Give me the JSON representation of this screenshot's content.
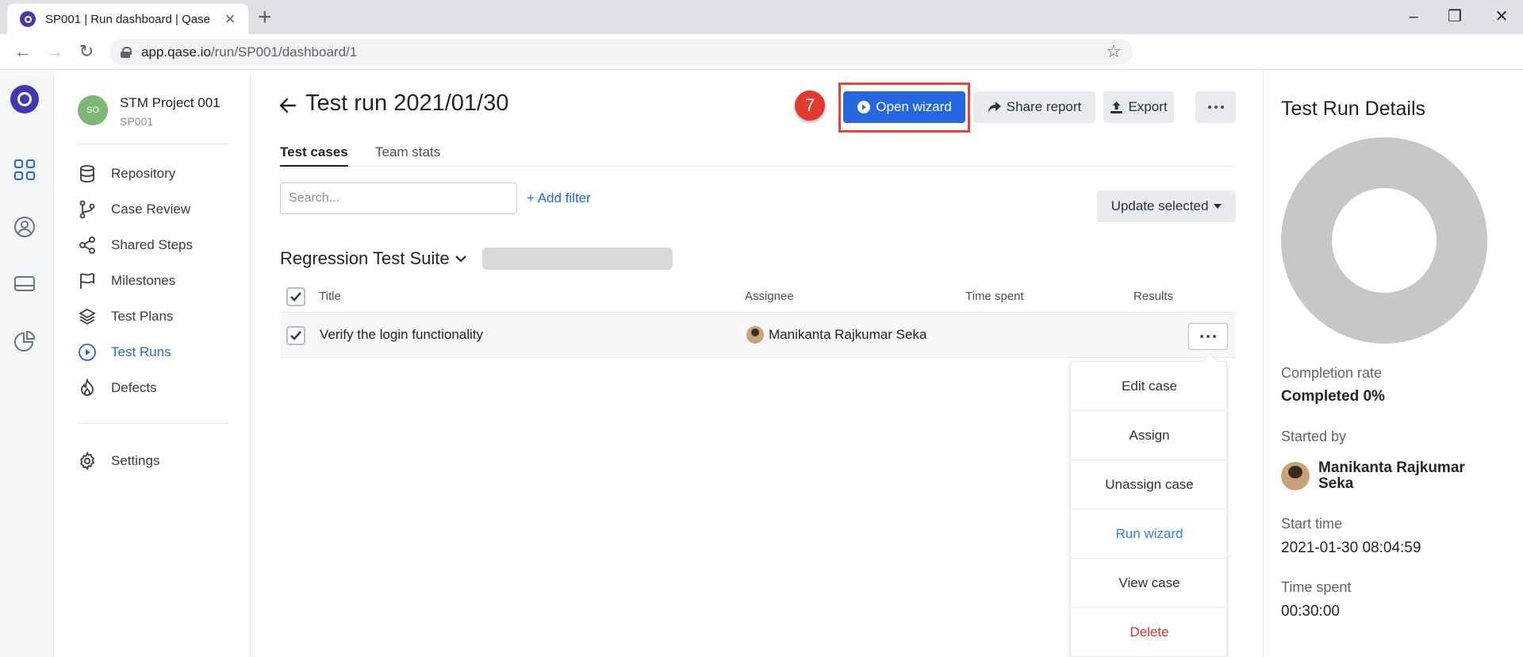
{
  "browser": {
    "tab_title": "SP001 | Run dashboard | Qase",
    "url_host": "app.qase.io",
    "url_path": "/run/SP001/dashboard/1"
  },
  "project": {
    "avatar_initials": "SO",
    "name": "STM Project 001",
    "code": "SP001"
  },
  "sidebar": {
    "items": [
      {
        "label": "Repository",
        "icon": "database-icon"
      },
      {
        "label": "Case Review",
        "icon": "git-branch-icon"
      },
      {
        "label": "Shared Steps",
        "icon": "share-icon"
      },
      {
        "label": "Milestones",
        "icon": "flag-icon"
      },
      {
        "label": "Test Plans",
        "icon": "layers-icon"
      },
      {
        "label": "Test Runs",
        "icon": "play-circle-icon"
      },
      {
        "label": "Defects",
        "icon": "fire-icon"
      }
    ],
    "settings_label": "Settings"
  },
  "header": {
    "title": "Test run 2021/01/30",
    "step_number": "7",
    "open_wizard": "Open wizard",
    "share_report": "Share report",
    "export": "Export"
  },
  "tabs": [
    {
      "label": "Test cases",
      "active": true
    },
    {
      "label": "Team stats",
      "active": false
    }
  ],
  "filters": {
    "search_placeholder": "Search...",
    "add_filter": "+ Add filter",
    "update_selected": "Update selected"
  },
  "suite": {
    "title": "Regression Test Suite"
  },
  "table": {
    "columns": [
      "Title",
      "Assignee",
      "Time spent",
      "Results"
    ],
    "rows": [
      {
        "title": "Verify the login functionality",
        "assignee": "Manikanta Rajkumar Seka",
        "time_spent": "",
        "checked": true
      }
    ]
  },
  "row_menu": {
    "items": [
      "Edit case",
      "Assign",
      "Unassign case",
      "Run wizard",
      "View case",
      "Delete"
    ]
  },
  "details": {
    "title": "Test Run Details",
    "completion_label": "Completion rate",
    "completion_value": "Completed 0%",
    "completion_percent": 0,
    "started_by_label": "Started by",
    "started_by_value": "Manikanta Rajkumar Seka",
    "start_time_label": "Start time",
    "start_time_value": "2021-01-30 08:04:59",
    "time_spent_label": "Time spent",
    "time_spent_value": "00:30:00"
  },
  "colors": {
    "primary": "#2467e0",
    "highlight": "#e2443b",
    "danger": "#d93025",
    "donut": "#c7c7c7"
  }
}
